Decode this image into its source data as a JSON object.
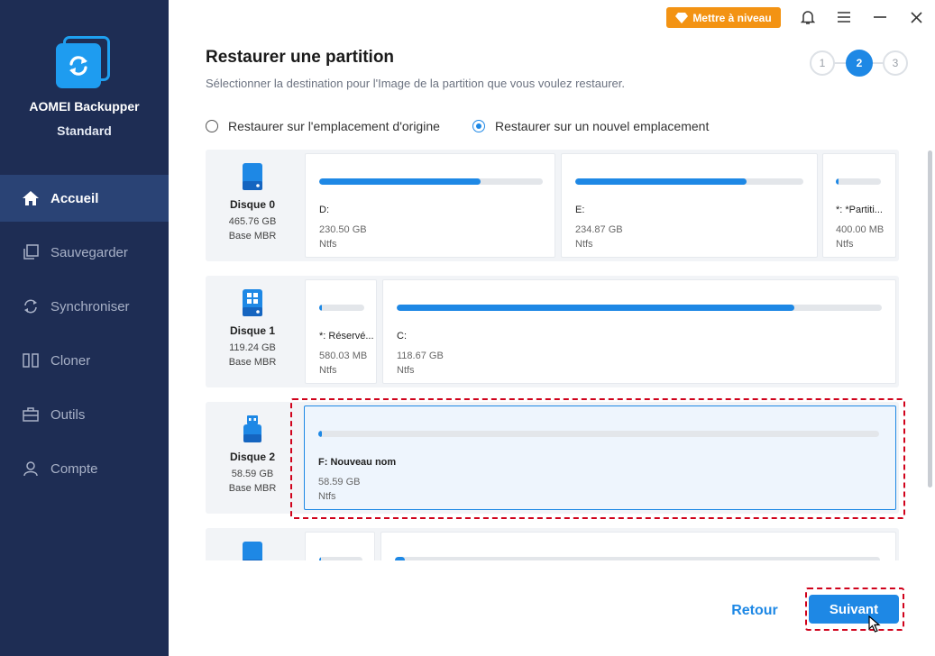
{
  "app": {
    "name": "AOMEI Backupper",
    "edition": "Standard"
  },
  "sidebar": {
    "items": [
      {
        "label": "Accueil",
        "icon": "home-icon",
        "active": true
      },
      {
        "label": "Sauvegarder",
        "icon": "backup-icon",
        "active": false
      },
      {
        "label": "Synchroniser",
        "icon": "sync-icon",
        "active": false
      },
      {
        "label": "Cloner",
        "icon": "clone-icon",
        "active": false
      },
      {
        "label": "Outils",
        "icon": "toolbox-icon",
        "active": false
      },
      {
        "label": "Compte",
        "icon": "user-icon",
        "active": false
      }
    ]
  },
  "titlebar": {
    "upgrade_label": "Mettre à niveau"
  },
  "page": {
    "title": "Restaurer une partition",
    "subtitle": "Sélectionner la destination pour l'Image de la partition que vous voulez restaurer.",
    "steps": [
      "1",
      "2",
      "3"
    ],
    "active_step": 2
  },
  "options": {
    "original": "Restaurer sur l'emplacement d'origine",
    "new": "Restaurer sur un nouvel emplacement",
    "selected": "new"
  },
  "disks": [
    {
      "name": "Disque 0",
      "size": "465.76 GB",
      "type": "Base MBR",
      "icon": "hdd-icon",
      "partitions": [
        {
          "name": "D:",
          "size": "230.50 GB",
          "fs": "Ntfs",
          "used": 0.72
        },
        {
          "name": "E:",
          "size": "234.87 GB",
          "fs": "Ntfs",
          "used": 0.75
        },
        {
          "name": "*: *Partiti...",
          "size": "400.00 MB",
          "fs": "Ntfs",
          "used": 0.05
        }
      ]
    },
    {
      "name": "Disque 1",
      "size": "119.24 GB",
      "type": "Base MBR",
      "icon": "windows-disk-icon",
      "partitions": [
        {
          "name": "*: Réservé...",
          "size": "580.03 MB",
          "fs": "Ntfs",
          "used": 0.05
        },
        {
          "name": "C:",
          "size": "118.67 GB",
          "fs": "Ntfs",
          "used": 0.82
        }
      ]
    },
    {
      "name": "Disque 2",
      "size": "58.59 GB",
      "type": "Base MBR",
      "icon": "usb-disk-icon",
      "partitions": [
        {
          "name": "F: Nouveau nom",
          "size": "58.59 GB",
          "fs": "Ntfs",
          "used": 0.005,
          "selected": true
        }
      ]
    },
    {
      "name": "",
      "size": "",
      "type": "",
      "icon": "hdd-icon",
      "partitions": [
        {
          "name": "",
          "size": "",
          "fs": "",
          "used": 0.05
        },
        {
          "name": "",
          "size": "",
          "fs": "",
          "used": 0.02
        }
      ]
    }
  ],
  "footer": {
    "back_label": "Retour",
    "next_label": "Suivant"
  },
  "colors": {
    "sidebar": "#1e2d54",
    "accent": "#1e88e5",
    "upgrade": "#f39313",
    "highlight": "#d0021b"
  }
}
